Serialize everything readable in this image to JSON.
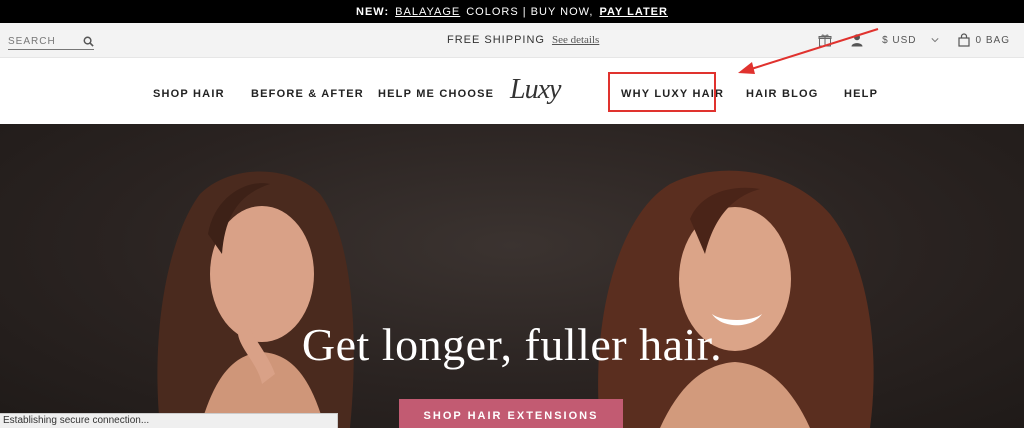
{
  "promo": {
    "prefix": "NEW:",
    "highlight": "BALAYAGE",
    "middle": "COLORS | BUY NOW,",
    "pay_later": "PAY LATER"
  },
  "util": {
    "search_placeholder": "SEARCH",
    "shipping": "FREE SHIPPING",
    "see_details": "See details",
    "currency": "$ USD",
    "bag": "0 BAG"
  },
  "nav": {
    "items": [
      "SHOP HAIR",
      "BEFORE & AFTER",
      "HELP ME CHOOSE",
      "WHY LUXY HAIR",
      "HAIR BLOG",
      "HELP"
    ],
    "logo": "Luxy"
  },
  "hero": {
    "headline": "Get longer, fuller hair.",
    "cta": "SHOP HAIR EXTENSIONS"
  },
  "status_bar": "Establishing secure connection...",
  "colors": {
    "cta": "#c25b72",
    "annotation": "#e0322e"
  }
}
